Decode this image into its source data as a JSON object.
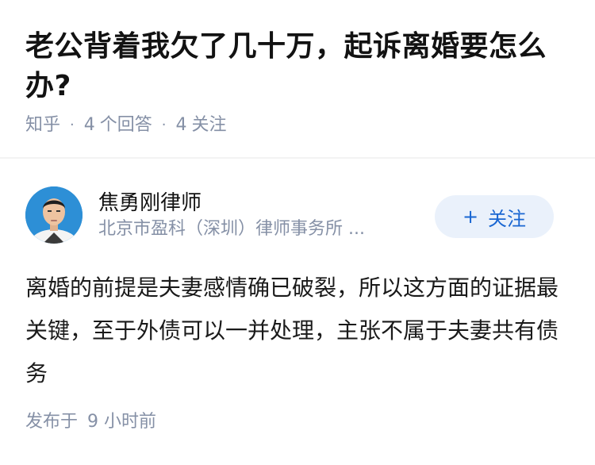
{
  "question": {
    "title": "老公背着我欠了几十万，起诉离婚要怎么办?",
    "source": "知乎",
    "answer_count": "4",
    "answer_label": "个回答",
    "follower_count": "4",
    "follower_label": "关注",
    "separator": "·"
  },
  "answer": {
    "author_name": "焦勇刚律师",
    "author_org": "北京市盈科（深圳）律师事务所 ...",
    "follow_label": "关注",
    "follow_icon": "+",
    "content": "离婚的前提是夫妻感情确已破裂，所以这方面的证据最关键，至于外债可以一并处理，主张不属于夫妻共有债务",
    "publish_prefix": "发布于",
    "publish_time": "9 小时前"
  },
  "colors": {
    "meta_gray": "#8590a6",
    "follow_blue": "#1966d2",
    "follow_bg": "#eaf1fb",
    "avatar_bg": "#2d8fd6"
  }
}
